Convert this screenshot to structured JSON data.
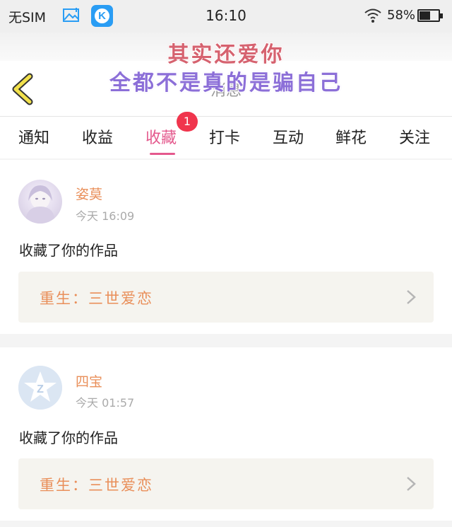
{
  "status_bar": {
    "carrier": "无SIM",
    "time": "16:10",
    "battery_percent": "58%",
    "battery_level": 0.58,
    "icons": [
      "image-icon",
      "app-k-icon",
      "wifi-icon",
      "battery-icon"
    ]
  },
  "header": {
    "title": "消息",
    "overlay_line_1": "其实还爱你",
    "overlay_line_2": "全都不是真的是骗自己"
  },
  "tabs": [
    {
      "label": "通知",
      "active": false
    },
    {
      "label": "收益",
      "active": false
    },
    {
      "label": "收藏",
      "active": true,
      "badge": "1"
    },
    {
      "label": "打卡",
      "active": false
    },
    {
      "label": "互动",
      "active": false
    },
    {
      "label": "鲜花",
      "active": false
    },
    {
      "label": "关注",
      "active": false
    }
  ],
  "notifications": [
    {
      "username": "姿莫",
      "time": "今天 16:09",
      "action": "收藏了你的作品",
      "work_title": "重生：三世爱恋"
    },
    {
      "username": "四宝",
      "time": "今天 01:57",
      "action": "收藏了你的作品",
      "work_title": "重生：三世爱恋"
    }
  ],
  "colors": {
    "accent_pink": "#e4598d",
    "badge_red": "#f0354d",
    "username_orange": "#e98f5a",
    "overlay_pink": "#d6626f",
    "overlay_purple": "#8c6fd8",
    "back_arrow_yellow": "#f2e14c"
  }
}
